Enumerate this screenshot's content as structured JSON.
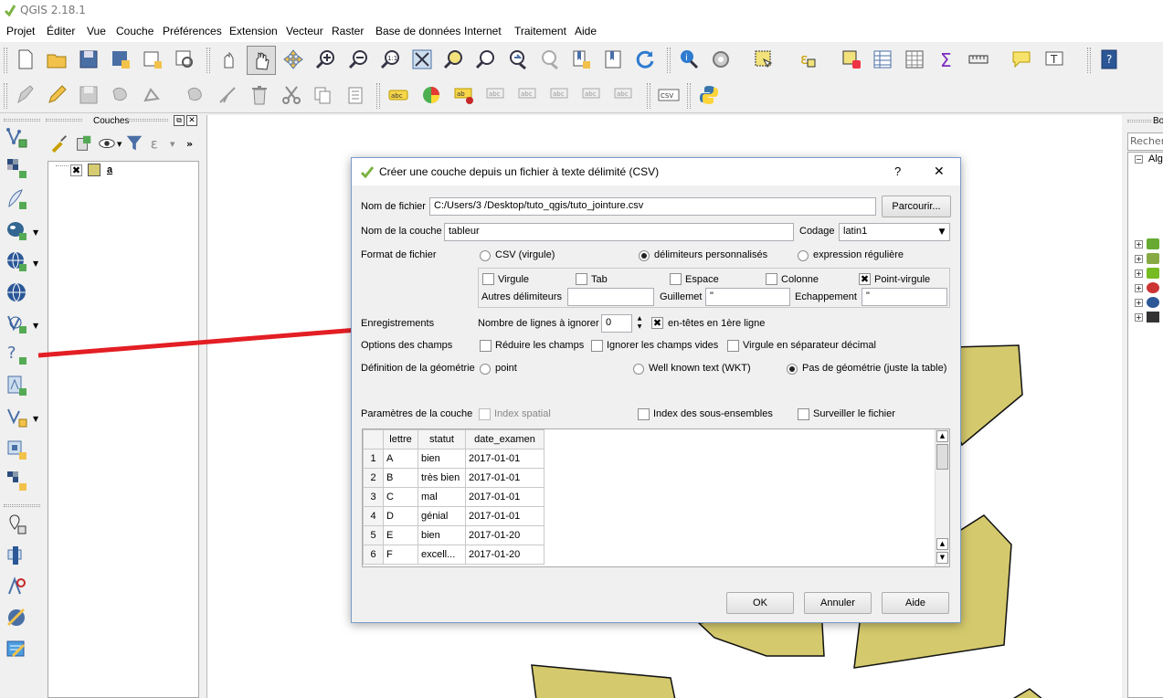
{
  "window": {
    "title": "QGIS 2.18.1"
  },
  "menu": [
    "Projet",
    "Éditer",
    "Vue",
    "Couche",
    "Préférences",
    "Extension",
    "Vecteur",
    "Raster",
    "Base de données",
    "Internet",
    "Traitement",
    "Aide"
  ],
  "layers_panel": {
    "title": "Couches",
    "layer": {
      "name": "a",
      "checked": true,
      "color": "#d6cb71"
    }
  },
  "right_panel": {
    "title": "Bo",
    "search": "Recher",
    "tree_item": "Alg"
  },
  "colors": {
    "polygon_fill": "#d4c96c",
    "polygon_stroke": "#111111",
    "annotation_line": "#e31e24",
    "dialog_border": "#7a9cc8"
  },
  "dialog": {
    "title": "Créer une couche depuis un fichier à texte délimité (CSV)",
    "help": "?",
    "close": "✕",
    "file_name_label": "Nom de fichier",
    "file_name_value": "C:/Users/3           /Desktop/tuto_qgis/tuto_jointure.csv",
    "browse": "Parcourir...",
    "layer_name_label": "Nom de la couche",
    "layer_name_value": "tableur",
    "encoding_label": "Codage",
    "encoding_value": "latin1",
    "format_label": "Format de fichier",
    "format_options": {
      "csv": "CSV (virgule)",
      "custom": "délimiteurs personnalisés",
      "regex": "expression régulière"
    },
    "delimiters": {
      "comma": "Virgule",
      "tab": "Tab",
      "space": "Espace",
      "colon": "Colonne",
      "semicolon": "Point-virgule"
    },
    "other_delims_label": "Autres délimiteurs",
    "quote_label": "Guillemet",
    "quote_value": "\"",
    "escape_label": "Echappement",
    "escape_value": "\"",
    "records_label": "Enregistrements",
    "skip_lines_label": "Nombre de lignes à ignorer",
    "skip_lines_value": "0",
    "header_label": "en-têtes en 1ère ligne",
    "field_options_label": "Options des champs",
    "trim_label": "Réduire les champs",
    "skip_empty_label": "Ignorer les champs vides",
    "decimal_comma_label": "Virgule en séparateur décimal",
    "geometry_label": "Définition de la géométrie",
    "geom_point": "point",
    "geom_wkt": "Well known text (WKT)",
    "geom_none": "Pas de géométrie (juste la table)",
    "layer_params_label": "Paramètres de la couche",
    "spatial_index": "Index spatial",
    "subset_index": "Index des sous-ensembles",
    "watch_file": "Surveiller le fichier",
    "ok": "OK",
    "cancel": "Annuler",
    "help_btn": "Aide"
  },
  "preview": {
    "columns": [
      "lettre",
      "statut",
      "date_examen"
    ],
    "rows": [
      [
        "1",
        "A",
        "bien",
        "2017-01-01"
      ],
      [
        "2",
        "B",
        "très bien",
        "2017-01-01"
      ],
      [
        "3",
        "C",
        "mal",
        "2017-01-01"
      ],
      [
        "4",
        "D",
        "génial",
        "2017-01-01"
      ],
      [
        "5",
        "E",
        "bien",
        "2017-01-20"
      ],
      [
        "6",
        "F",
        "excell...",
        "2017-01-20"
      ]
    ]
  }
}
